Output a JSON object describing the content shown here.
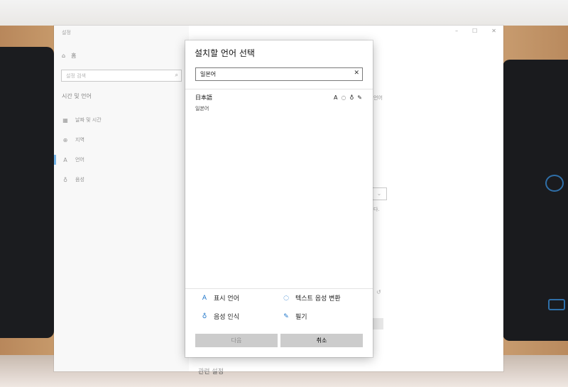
{
  "window": {
    "title": "설정",
    "controls": {
      "minimize": "–",
      "maximize": "☐",
      "close": "✕"
    }
  },
  "sidebar": {
    "home_label": "홈",
    "search_placeholder": "설정 검색",
    "section_title": "시간 및 언어",
    "items": [
      {
        "label": "날짜 및 시간",
        "icon": "calendar-clock-icon"
      },
      {
        "label": "지역",
        "icon": "globe-icon"
      },
      {
        "label": "언어",
        "icon": "language-icon",
        "selected": true
      },
      {
        "label": "음성",
        "icon": "microphone-icon"
      }
    ]
  },
  "main": {
    "fragments": {
      "lang_frag": "언어",
      "period_frag": "다."
    },
    "related_settings_label": "관련 설정"
  },
  "dialog": {
    "title": "설치할 언어 선택",
    "search_value": "일본어",
    "clear_symbol": "✕",
    "results": [
      {
        "name": "日本語",
        "subtitle": "일본어",
        "feature_icons": [
          "display-language-icon",
          "text-to-speech-icon",
          "speech-recognition-icon",
          "handwriting-icon"
        ]
      }
    ],
    "legend": {
      "display_language": "표시 언어",
      "text_to_speech": "텍스트 음성 변환",
      "speech_recognition": "음성 인식",
      "handwriting": "필기"
    },
    "buttons": {
      "next": "다음",
      "cancel": "취소"
    }
  },
  "colors": {
    "accent": "#0078d7",
    "icon_blue": "#1a73c9",
    "button_gray": "#cccccc"
  }
}
